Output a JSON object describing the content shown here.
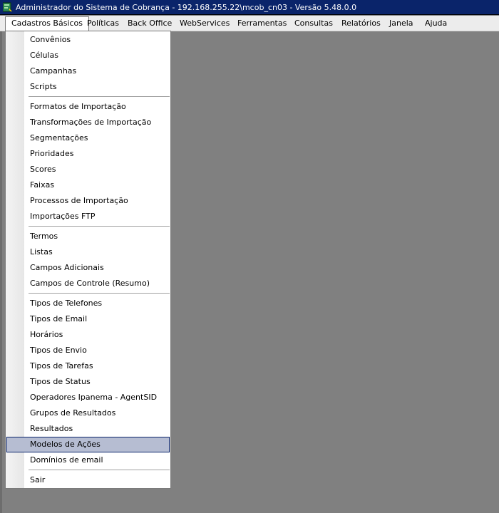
{
  "window": {
    "title": "Administrador do Sistema de Cobrança - 192.168.255.22\\mcob_cn03 - Versão 5.48.0.0",
    "icon": "app-icon"
  },
  "menubar": {
    "items": [
      {
        "label": "Cadastros Básicos"
      },
      {
        "label": "Políticas"
      },
      {
        "label": "Back Office"
      },
      {
        "label": "WebServices"
      },
      {
        "label": "Ferramentas"
      },
      {
        "label": "Consultas"
      },
      {
        "label": "Relatórios"
      },
      {
        "label": "Janela"
      },
      {
        "label": "Ajuda"
      }
    ]
  },
  "dropdown": {
    "items": [
      {
        "label": "Convênios"
      },
      {
        "label": "Células"
      },
      {
        "label": "Campanhas"
      },
      {
        "label": "Scripts"
      },
      {
        "label": "Formatos de Importação"
      },
      {
        "label": "Transformações de Importação"
      },
      {
        "label": "Segmentações"
      },
      {
        "label": "Prioridades"
      },
      {
        "label": "Scores"
      },
      {
        "label": "Faixas"
      },
      {
        "label": "Processos de Importação"
      },
      {
        "label": "Importações FTP"
      },
      {
        "label": "Termos"
      },
      {
        "label": "Listas"
      },
      {
        "label": "Campos Adicionais"
      },
      {
        "label": "Campos de Controle (Resumo)"
      },
      {
        "label": "Tipos de Telefones"
      },
      {
        "label": "Tipos de Email"
      },
      {
        "label": "Horários"
      },
      {
        "label": "Tipos de Envio"
      },
      {
        "label": "Tipos de Tarefas"
      },
      {
        "label": "Tipos de Status"
      },
      {
        "label": "Operadores Ipanema - AgentSID"
      },
      {
        "label": "Grupos de Resultados"
      },
      {
        "label": "Resultados"
      },
      {
        "label": "Modelos de Ações"
      },
      {
        "label": "Domínios de email"
      },
      {
        "label": "Sair"
      }
    ]
  },
  "colors": {
    "titlebar": "#0a246a",
    "highlight": "#b6bdd2",
    "workspace": "#808080"
  }
}
